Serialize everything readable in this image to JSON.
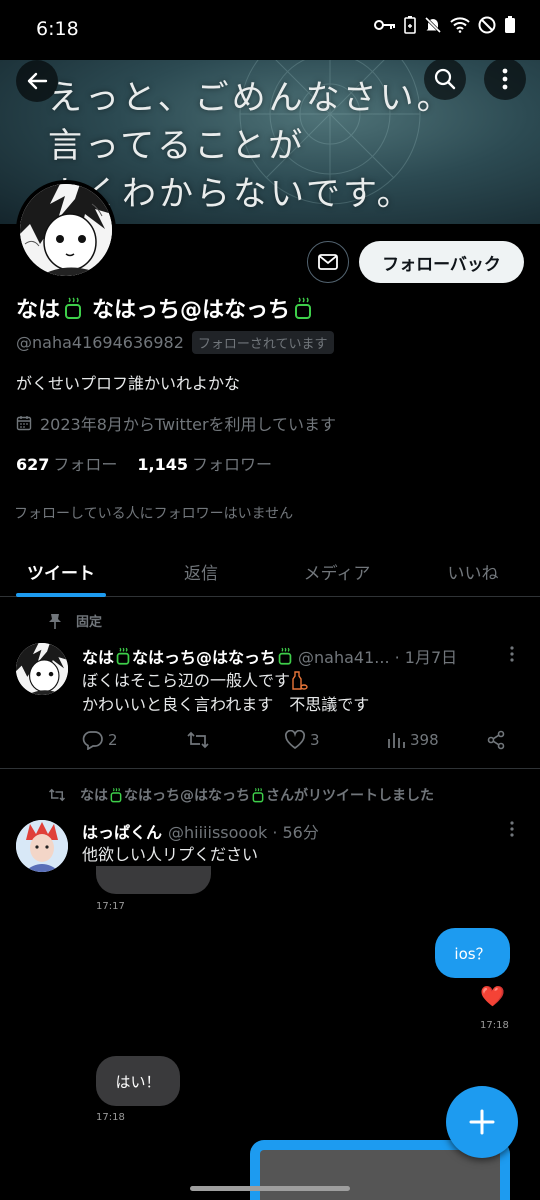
{
  "status": {
    "time": "6:18"
  },
  "banner": {
    "lines": [
      "えっと、ごめんなさい。",
      "言ってることが",
      "よくわからないです。"
    ]
  },
  "profile": {
    "name_part1": "なは",
    "name_part2": "なはっち@はなっち",
    "handle": "@naha41694636982",
    "follows_you": "フォローされています",
    "bio": "がくせいプロフ誰かいれよかな",
    "joined": "2023年8月からTwitterを利用しています",
    "following_count": "627",
    "following_label": "フォロー",
    "followers_count": "1,145",
    "followers_label": "フォロワー",
    "known_followers": "フォローしている人にフォロワーはいません"
  },
  "buttons": {
    "follow_back": "フォローバック"
  },
  "tabs": [
    {
      "label": "ツイート"
    },
    {
      "label": "返信"
    },
    {
      "label": "メディア"
    },
    {
      "label": "いいね"
    }
  ],
  "pinned_tweet": {
    "pinned_label": "固定",
    "name_part1": "なは",
    "name_part2": "なはっち@はなっち",
    "meta": "@naha41... · 1月7日",
    "line1": "ぼくはそこら辺の一般人です",
    "line2": "かわいいと良く言われます　不思議です",
    "replies": "2",
    "likes": "3",
    "views": "398"
  },
  "retweet": {
    "label": "なは 🍵 なはっち@はなっち 🍵 さんがリツイートしました",
    "label_part1": "なは",
    "label_part2": "なはっち@はなっち",
    "label_part3": "さんがリツイートしました",
    "name": "はっぱくん",
    "meta": "@hiiiissoook · 56分",
    "text": "他欲しい人リプください"
  },
  "chat": {
    "time1": "17:17",
    "bubble_ios": "ios？",
    "heart": "❤️",
    "time2": "17:18",
    "bubble_hai": "はい！",
    "time3": "17:18"
  },
  "colors": {
    "accent": "#1d9bf0",
    "leaf_green": "#3ecf4a"
  }
}
